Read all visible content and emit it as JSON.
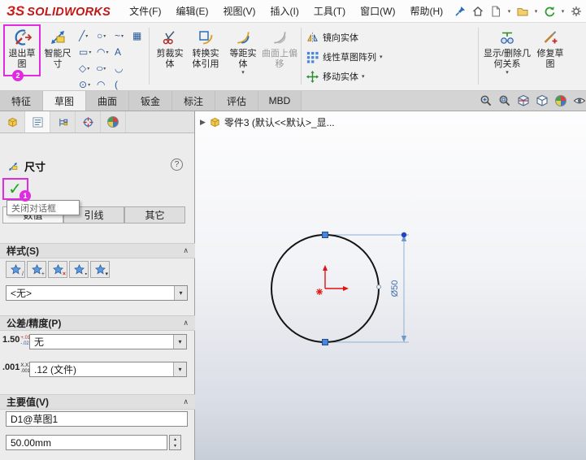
{
  "menubar": {
    "logo_ds": "ЗS",
    "logo_brand": "SOLIDWORKS",
    "menus": [
      "文件(F)",
      "编辑(E)",
      "视图(V)",
      "插入(I)",
      "工具(T)",
      "窗口(W)",
      "帮助(H)"
    ]
  },
  "ribbon": {
    "exit_sketch": "退出草图",
    "smart_dimension": "智能尺寸",
    "trim": "剪裁实体",
    "convert": "转换实体引用",
    "offset": "等距实体",
    "surface_offset": "曲面上偏移",
    "mirror": "镜向实体",
    "linear_pattern": "线性草图阵列",
    "move": "移动实体",
    "display_relations": "显示/删除几何关系",
    "repair": "修复草图"
  },
  "tabs": [
    "特征",
    "草图",
    "曲面",
    "钣金",
    "标注",
    "评估",
    "MBD"
  ],
  "panel": {
    "title": "尺寸",
    "help": "?",
    "confirm_tooltip": "关闭对话框",
    "tabs": [
      "数值",
      "引线",
      "其它"
    ],
    "style_section": "样式(S)",
    "style_value": "<无>",
    "tolerance_section": "公差/精度(P)",
    "tol1_main": "1.50",
    "tol1_sup": "+.01",
    "tol1_sub": "-.02",
    "tol1_value": "无",
    "tol2_main": ".001",
    "tol2_sup": "X.XX",
    "tol2_sub": ".001",
    "tol2_value": ".12 (文件)",
    "primary_section": "主要值(V)",
    "dim_name": "D1@草图1",
    "dim_value": "50.00mm"
  },
  "viewport": {
    "tree_item": "零件3 (默认<<默认>_显...",
    "dimension": "Ø50"
  },
  "badges": {
    "one": "1",
    "two": "2"
  },
  "glyphs": {
    "dropdown": "▾",
    "collapse": "∧",
    "check": "✓",
    "tree_expand": "▶",
    "line": "╱",
    "circle": "○",
    "spline": "~",
    "cube": "▦",
    "rect": "▭",
    "arc": "◠",
    "text_tool": "A",
    "polygon": "◇",
    "ellipse": "○",
    "fillet": "◡",
    "slot": "⊙",
    "arc2": "◠",
    "conic": "(",
    "spin_up": "▴",
    "spin_down": "▾",
    "mark_plus": "+",
    "mark_x": "×",
    "mark_box": "▪",
    "mark_down": "▾",
    "mark_pen": "/"
  },
  "colors": {
    "accent_magenta": "#e02ce0",
    "logo_red": "#cf1a1a",
    "check_green": "#1ea51e",
    "dimension_blue": "#3f6fa8",
    "handle_blue": "#4a86d8",
    "center_red": "#e01212"
  }
}
